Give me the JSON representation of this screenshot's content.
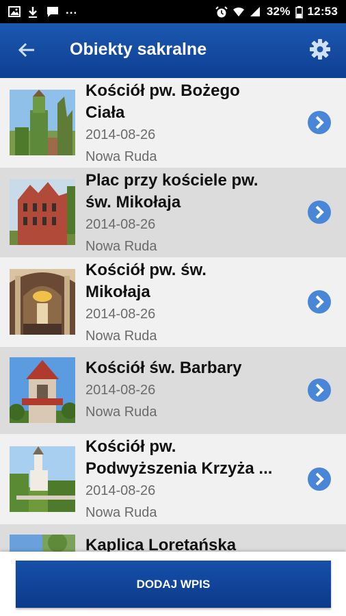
{
  "status_bar": {
    "battery": "32%",
    "time": "12:53",
    "dots": "...",
    "left_icons": [
      "image-icon",
      "download-icon",
      "message-icon"
    ],
    "right_icons": [
      "alarm-icon",
      "wifi-icon",
      "signal-icon",
      "battery-icon"
    ]
  },
  "app_bar": {
    "title": "Obiekty sakralne",
    "back_icon": "arrow-back-icon",
    "settings_icon": "gear-icon",
    "color": "#1a54a8"
  },
  "items": [
    {
      "title_line1": "Kościół pw. Bożego",
      "title_line2": "Ciała",
      "date": "2014-08-26",
      "location": "Nowa Ruda"
    },
    {
      "title_line1": "Plac przy kościele pw.",
      "title_line2": "św. Mikołaja",
      "date": "2014-08-26",
      "location": "Nowa Ruda"
    },
    {
      "title_line1": "Kościół pw. św.",
      "title_line2": "Mikołaja",
      "date": "2014-08-26",
      "location": "Nowa Ruda"
    },
    {
      "title_line1": "Kościół św. Barbary",
      "title_line2": "",
      "date": "2014-08-26",
      "location": "Nowa Ruda"
    },
    {
      "title_line1": "Kościół pw.",
      "title_line2": "Podwyższenia Krzyża ...",
      "date": "2014-08-26",
      "location": "Nowa Ruda"
    },
    {
      "title_line1": "Kaplica Loretańska",
      "title_line2": "",
      "date": "",
      "location": ""
    }
  ],
  "chevron_color": "#4a86d8",
  "add_button": {
    "label": "DODAJ WPIS"
  }
}
